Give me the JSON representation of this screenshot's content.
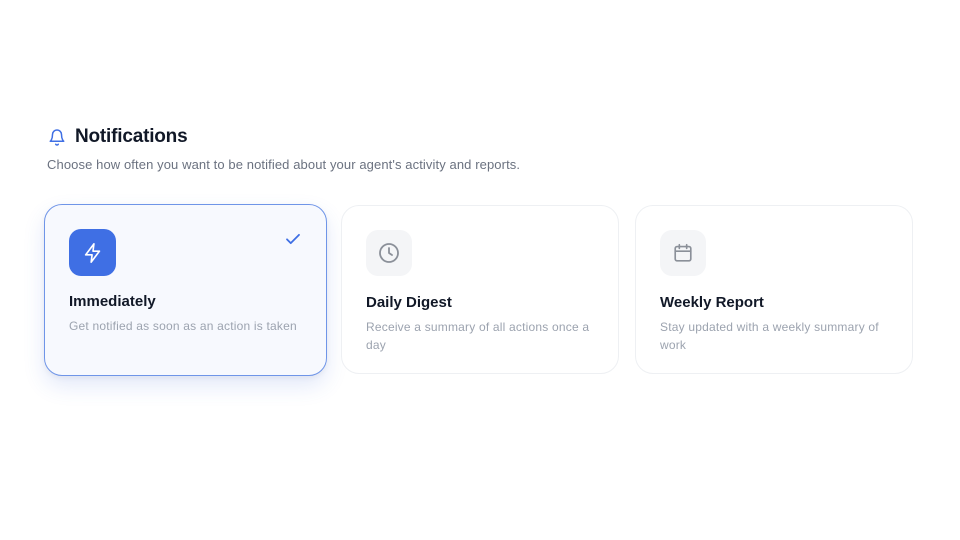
{
  "header": {
    "icon": "bell-icon",
    "title": "Notifications",
    "subtitle": "Choose how often you want to be notified about your agent's activity and reports."
  },
  "options": [
    {
      "icon": "lightning-icon",
      "title": "Immediately",
      "description": "Get notified as soon as an action is taken",
      "selected": true
    },
    {
      "icon": "clock-icon",
      "title": "Daily Digest",
      "description": "Receive a summary of all actions once a day",
      "selected": false
    },
    {
      "icon": "calendar-icon",
      "title": "Weekly Report",
      "description": "Stay updated with a weekly summary of work",
      "selected": false
    }
  ],
  "colors": {
    "accent": "#3f6fe4",
    "selected_border": "#6f95e8",
    "selected_bg": "#f7f9fe",
    "muted_text": "#9ca3af",
    "icon_gray": "#9ca3af"
  }
}
